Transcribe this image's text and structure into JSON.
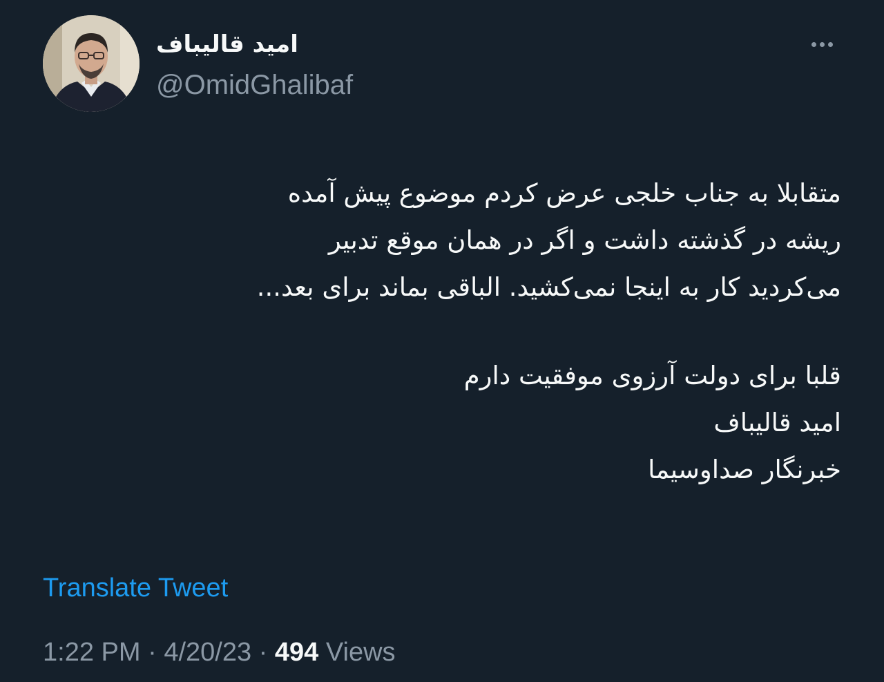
{
  "author": {
    "display_name": "امید قالیباف",
    "handle": "@OmidGhalibaf",
    "avatar_icon": "profile-photo"
  },
  "menu": {
    "more_icon": "more-horizontal-icon"
  },
  "tweet": {
    "lines": [
      "متقابلا به جناب خلجی عرض کردم موضوع پیش آمده",
      "ریشه در گذشته داشت و اگر در همان موقع تدبیر",
      "می‌کردید کار به اینجا نمی‌کشید. الباقی بماند برای بعد...",
      "قلبا برای دولت آرزوی موفقیت دارم",
      "امید قالیباف",
      "خبرنگار صداوسیما"
    ]
  },
  "translate_label": "Translate Tweet",
  "meta": {
    "time": "1:22 PM",
    "separator": " · ",
    "date": "4/20/23",
    "views_count": "494",
    "views_label": " Views"
  },
  "colors": {
    "background": "#15202b",
    "text_primary": "#f7f9f9",
    "text_secondary": "#8b98a5",
    "link": "#1d9bf0"
  }
}
